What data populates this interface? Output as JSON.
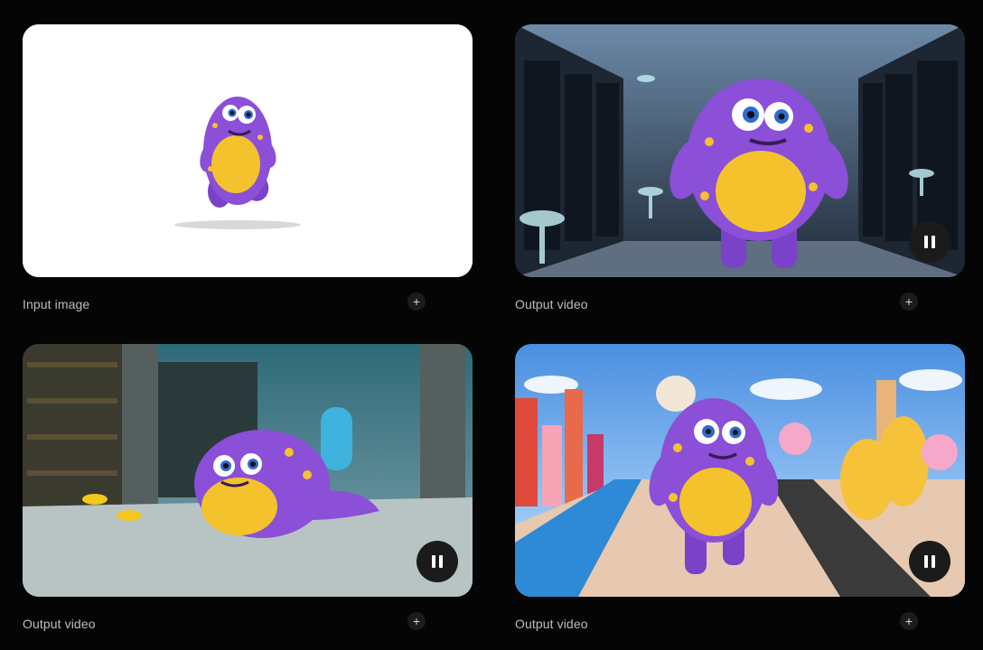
{
  "cards": [
    {
      "caption": "Input image",
      "add_icon": "plus-icon",
      "scene": "purple fuzzy monster walking on white background"
    },
    {
      "caption": "Output video",
      "add_icon": "plus-icon",
      "control_icon": "pause-icon",
      "scene": "purple monster in server room with glowing mushrooms"
    },
    {
      "caption": "Output video",
      "add_icon": "plus-icon",
      "control_icon": "pause-icon",
      "scene": "purple monster swimming in underwater library"
    },
    {
      "caption": "Output video",
      "add_icon": "plus-icon",
      "control_icon": "pause-icon",
      "scene": "purple monster walking in candy city"
    }
  ],
  "colors": {
    "background": "#050505",
    "caption": "#bdbdbd",
    "monster_purple": "#8b4fd8",
    "monster_belly": "#f4c22c"
  }
}
